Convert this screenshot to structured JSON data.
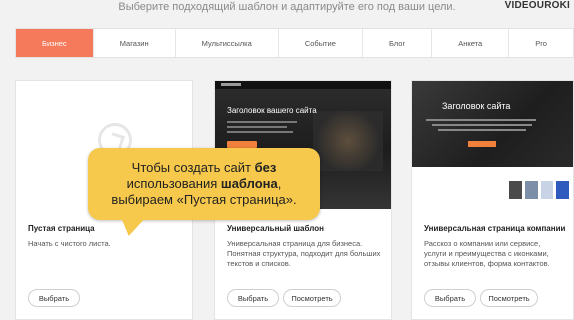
{
  "header": {
    "subtitle": "Выберите подходящий шаблон и адаптируйте его под ваши цели.",
    "brand": "VIDEOUROKI"
  },
  "tabs": [
    {
      "label": "Бизнес",
      "active": true
    },
    {
      "label": "Магазин",
      "active": false
    },
    {
      "label": "Мультиссылка",
      "active": false
    },
    {
      "label": "Событие",
      "active": false
    },
    {
      "label": "Блог",
      "active": false
    },
    {
      "label": "Анкета",
      "active": false
    },
    {
      "label": "Pro",
      "active": false
    }
  ],
  "cards": [
    {
      "title": "Пустая страница",
      "description": "Начать с чистого листа.",
      "buttons": [
        "Выбрать"
      ]
    },
    {
      "title": "Универсальный шаблон",
      "thumb_title": "Заголовок вашего сайта",
      "description": "Универсальная страница для бизнеса. Понятная структура, подходит для больших текстов и списков.",
      "buttons": [
        "Выбрать",
        "Посмотреть"
      ]
    },
    {
      "title": "Универсальная страница компании",
      "thumb_title": "Заголовок сайта",
      "description": "Расскоз о компании или сервисе, услуги и преимущества с иконками, отзывы клиентов, форма контактов.",
      "buttons": [
        "Выбрать",
        "Посмотреть"
      ]
    }
  ],
  "tooltip": {
    "part1": "Чтобы создать сайт ",
    "bold1": "без",
    "part2": "использования ",
    "bold2": "шаблона",
    "part3": ",",
    "part4": "выбираем «Пустая страница»."
  },
  "colors": {
    "accent": "#f47a5b",
    "tooltip_bg": "#f6c94c"
  }
}
